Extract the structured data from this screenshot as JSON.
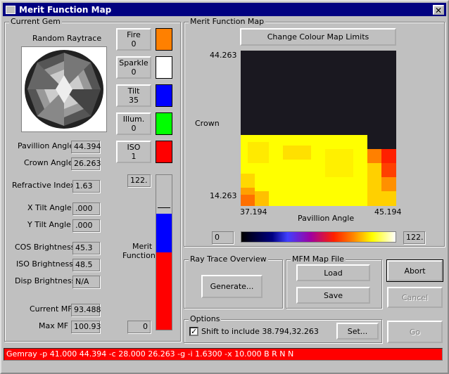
{
  "window": {
    "title": "Merit Function Map",
    "close_label": "✕"
  },
  "current_gem": {
    "group_label": "Current Gem",
    "image_title": "Random Raytrace",
    "buttons": [
      {
        "label": "Fire",
        "value": "0",
        "color": "#ff8000"
      },
      {
        "label": "Sparkle",
        "value": "0",
        "color": "#ffffff"
      },
      {
        "label": "Tilt",
        "value": "35",
        "color": "#0000ff"
      },
      {
        "label": "Illum.",
        "value": "0",
        "color": "#00ff00"
      },
      {
        "label": "ISO",
        "value": "1",
        "color": "#ff0000"
      }
    ],
    "fields": {
      "pavillion_angle": {
        "label": "Pavillion Angle",
        "value": "44.394"
      },
      "crown_angle": {
        "label": "Crown Angle",
        "value": "26.263"
      },
      "refractive_index": {
        "label": "Refractive Index",
        "value": "1.63"
      },
      "x_tilt": {
        "label": "X Tilt Angle",
        "value": ".000"
      },
      "y_tilt": {
        "label": "Y Tilt Angle",
        "value": ".000"
      },
      "cos_brightness": {
        "label": "COS Brightness",
        "value": "45.3"
      },
      "iso_brightness": {
        "label": "ISO Brightness",
        "value": "48.5"
      },
      "disp_brightness": {
        "label": "Disp Brightness",
        "value": "N/A"
      },
      "current_mf": {
        "label": "Current MF",
        "value": "93.488"
      },
      "max_mf": {
        "label": "Max MF",
        "value": "100.93"
      }
    },
    "merit": {
      "label_top": "Merit",
      "label_bottom": "Function",
      "max_value": "122.",
      "min_value": "0",
      "red_fraction": 0.5,
      "blue_fraction": 0.25
    }
  },
  "mfm": {
    "group_label": "Merit Function Map",
    "change_limits_label": "Change Colour Map Limits",
    "y_label": "Crown",
    "x_label": "Pavillion Angle",
    "y_max": "44.263",
    "y_min": "14.263",
    "x_min": "37.194",
    "x_max": "45.194",
    "scale_min": "0",
    "scale_max": "122."
  },
  "ray_trace": {
    "group_label": "Ray Trace Overview",
    "generate_label": "Generate..."
  },
  "mfm_file": {
    "group_label": "MFM Map File",
    "load_label": "Load",
    "save_label": "Save"
  },
  "actions": {
    "abort_label": "Abort",
    "cancel_label": "Cancel",
    "go_label": "Go"
  },
  "options": {
    "group_label": "Options",
    "shift_label": "Shift to include 38.794,32.263",
    "shift_checked": "✓",
    "set_label": "Set..."
  },
  "status": {
    "command": "Gemray -p 41.000 44.394 -c 28.000 26.263 -g -i 1.6300 -x 10.000 B R N N"
  }
}
